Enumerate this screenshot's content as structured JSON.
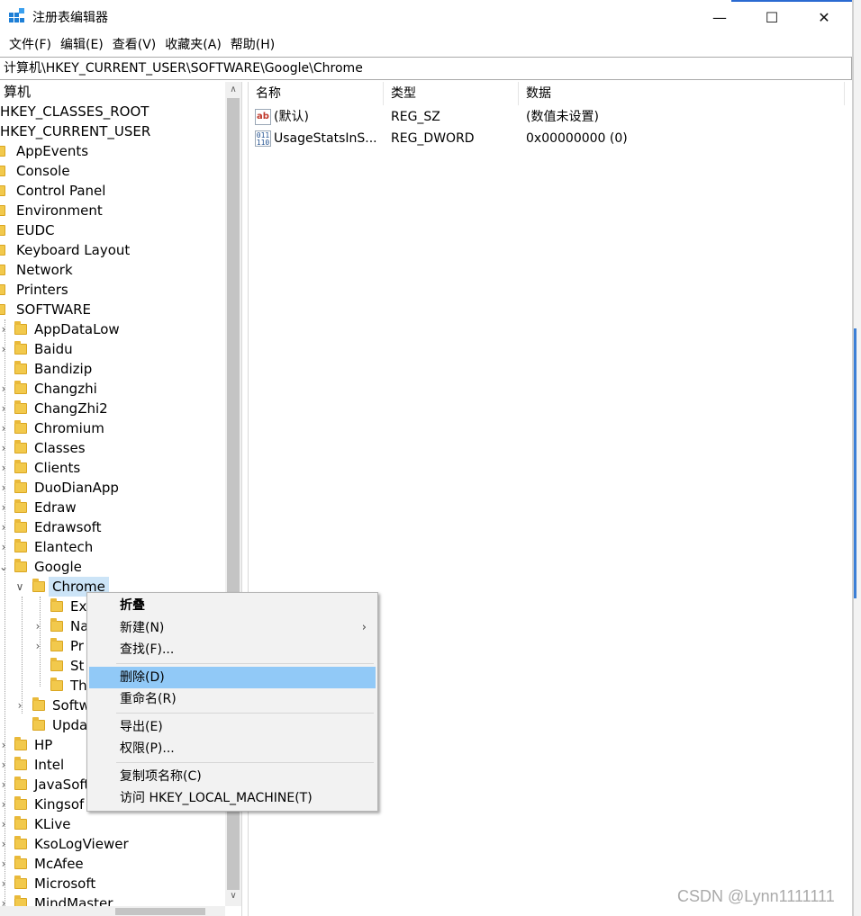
{
  "window": {
    "title": "注册表编辑器",
    "minimize_glyph": "—",
    "maximize_glyph": "☐",
    "close_glyph": "✕"
  },
  "menu": [
    "文件(F)",
    "编辑(E)",
    "查看(V)",
    "收藏夹(A)",
    "帮助(H)"
  ],
  "address": "计算机\\HKEY_CURRENT_USER\\SOFTWARE\\Google\\Chrome",
  "tree": {
    "root": "算机",
    "hives": [
      "HKEY_CLASSES_ROOT",
      "HKEY_CURRENT_USER"
    ],
    "hkcu_children": [
      "AppEvents",
      "Console",
      "Control Panel",
      "Environment",
      "EUDC",
      "Keyboard Layout",
      "Network",
      "Printers",
      "SOFTWARE"
    ],
    "software_children_top": [
      "AppDataLow",
      "Baidu",
      "Bandizip",
      "Changzhi",
      "ChangZhi2",
      "Chromium",
      "Classes",
      "Clients",
      "DuoDianApp",
      "Edraw",
      "Edrawsoft",
      "Elantech",
      "Google"
    ],
    "selected": "Chrome",
    "chrome_children": [
      "Ex",
      "Na",
      "Pr",
      "St",
      "Th"
    ],
    "google_other_children": [
      "Softw",
      "Upda"
    ],
    "software_children_bottom": [
      "HP",
      "Intel",
      "JavaSoft",
      "Kingsof",
      "KLive",
      "KsoLogViewer",
      "McAfee",
      "Microsoft",
      "MindMaster"
    ]
  },
  "list": {
    "columns": [
      "名称",
      "类型",
      "数据"
    ],
    "rows": [
      {
        "icon": "ab",
        "icon_name": "string-value-icon",
        "name": "(默认)",
        "type": "REG_SZ",
        "data": "(数值未设置)"
      },
      {
        "icon": "011\n110",
        "icon_name": "dword-value-icon",
        "name": "UsageStatsInS...",
        "type": "REG_DWORD",
        "data": "0x00000000 (0)"
      }
    ]
  },
  "context_menu": {
    "items": [
      {
        "label": "折叠",
        "bold": true
      },
      {
        "label": "新建(N)",
        "submenu": true
      },
      {
        "label": "查找(F)..."
      },
      {
        "label": "删除(D)",
        "highlighted": true
      },
      {
        "label": "重命名(R)"
      },
      {
        "label": "导出(E)"
      },
      {
        "label": "权限(P)..."
      },
      {
        "label": "复制项名称(C)"
      },
      {
        "label": "访问 HKEY_LOCAL_MACHINE(T)"
      }
    ],
    "submenu_glyph": "›"
  },
  "scroll": {
    "up_glyph": "∧",
    "down_glyph": "∨"
  },
  "watermark": "CSDN @Lynn1111111"
}
